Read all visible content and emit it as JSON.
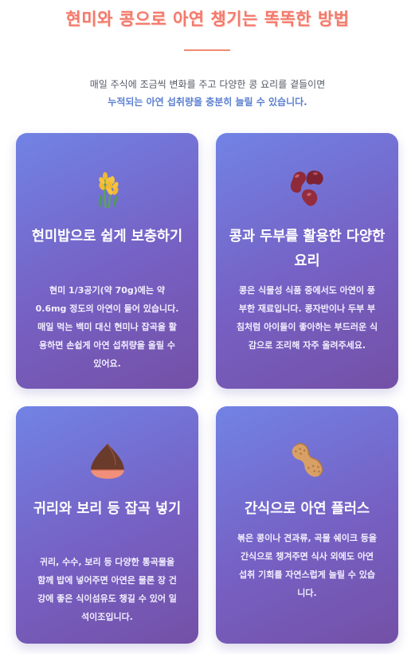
{
  "header": {
    "title": "현미와 콩으로 아연 챙기는 똑똑한 방법",
    "intro_line1": "매일 주식에 조금씩 변화를 주고 다양한 콩 요리를 곁들이면",
    "intro_line2": "누적되는 아연 섭취량을 충분히 늘릴 수 있습니다."
  },
  "cards": [
    {
      "icon": "rice-stalk-icon",
      "title": "현미밥으로 쉽게 보충하기",
      "body": "현미 1/3공기(약 70g)에는 약 0.6mg 정도의 아연이 들어 있습니다. 매일 먹는 백미 대신 현미나 잡곡을 활용하면 손쉽게 아연 섭취량을 올릴 수 있어요."
    },
    {
      "icon": "kidney-beans-icon",
      "title": "콩과 두부를 활용한 다양한 요리",
      "body": "콩은 식물성 식품 중에서도 아연이 풍부한 재료입니다. 콩자반이나 두부 부침처럼 아이들이 좋아하는 부드러운 식감으로 조리해 자주 올려주세요."
    },
    {
      "icon": "chestnut-icon",
      "title": "귀리와 보리 등 잡곡 넣기",
      "body": "귀리, 수수, 보리 등 다양한 통곡물을 함께 밥에 넣어주면 아연은 물론 장 건강에 좋은 식이섬유도 챙길 수 있어 일석이조입니다."
    },
    {
      "icon": "peanut-icon",
      "title": "간식으로 아연 플러스",
      "body": "볶은 콩이나 견과류, 곡물 쉐이크 등을 간식으로 챙겨주면 식사 외에도 아연 섭취 기회를 자연스럽게 늘릴 수 있습니다."
    }
  ]
}
